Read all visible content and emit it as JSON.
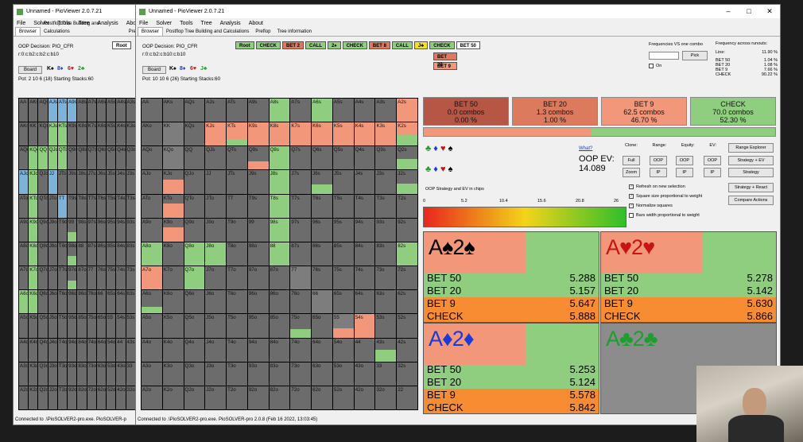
{
  "back_window": {
    "title": "Unnamed - PioViewer 2.0.7.21",
    "menu": [
      "File",
      "Solver",
      "Tools",
      "Tree",
      "Analysis",
      "Abo"
    ],
    "tabs": [
      "Browser",
      "Postflop Tree Building and Calculations",
      "Pre"
    ],
    "oop_decision": "OOP Decision:  PIO_CFR",
    "actions_line": "r:0:c:b2:c:b2:c:b10",
    "board_label": "Board",
    "board_cards": [
      "K♠",
      "8♦",
      "6♥",
      "2♣"
    ],
    "pot_line": "Pot: 2 10 6 (18) Starting Stacks:60",
    "root_label": "Root",
    "status": "Connected to .\\PioSOLVER2-pro.exe. PioSOLVER-p"
  },
  "window": {
    "title": "Unnamed - PioViewer 2.0.7.21",
    "controls": [
      "–",
      "□",
      "✕"
    ],
    "menu": [
      "File",
      "Solver",
      "Tools",
      "Tree",
      "Analysis",
      "About"
    ],
    "tabs": [
      "Browser",
      "Postflop Tree Building and Calculations",
      "Preflop",
      "Tree information"
    ],
    "oop_decision": "OOP Decision:  PIO_CFR",
    "actions_line": "r:0:c:b2:c:b10:c:b10",
    "board_label": "Board",
    "board_cards": [
      "K♠",
      "8♦",
      "6♥",
      "J♣"
    ],
    "pot_line": "Pot: 10 10 6 (26) Starting Stacks:60",
    "status": "Connected to .\\PioSOLVER2-pro.exe. PioSOLVER-pro 2.0.8 (Feb 16 2022, 13:03:45)"
  },
  "action_bar": [
    "Root",
    "CHECK",
    "BET 2",
    "CALL",
    "2♠",
    "CHECK",
    "BET 8",
    "CALL",
    "J♣",
    "CHECK",
    "BET 50"
  ],
  "dropdown": [
    "BET 20",
    "BET 9"
  ],
  "freq_panel": {
    "title": "Frequencies VS one combo",
    "pick_label": "Pick",
    "on_label": "On",
    "freq_title": "Frequency across runouts:",
    "line_label": "Line:",
    "line_value": "11.90 %",
    "rows": [
      {
        "name": "BET 50",
        "value": "1.04 %"
      },
      {
        "name": "BET 20",
        "value": "1.08 %"
      },
      {
        "name": "BET 9",
        "value": "7.66 %"
      },
      {
        "name": "CHECK",
        "value": "90.22 %"
      }
    ]
  },
  "strategy_boxes": [
    {
      "name": "BET 50",
      "combos": "0.0 combos",
      "pct": "0.00 %",
      "color": "#b65645"
    },
    {
      "name": "BET 20",
      "combos": "1.3 combos",
      "pct": "1.00 %",
      "color": "#dc7a5e"
    },
    {
      "name": "BET 9",
      "combos": "62.5 combos",
      "pct": "46.70 %",
      "color": "#f3977a"
    },
    {
      "name": "CHECK",
      "combos": "70.0 combos",
      "pct": "52.30 %",
      "color": "#8fce7f"
    }
  ],
  "freq_bar": {
    "check_fraction": 0.523
  },
  "ev": {
    "what_label": "What?",
    "label": "OOP EV:",
    "value": "14.089",
    "chart_label": "OOP Strategy and EV in chips",
    "ticks": [
      "0",
      "5.2",
      "10.4",
      "15.6",
      "20.8",
      "26"
    ]
  },
  "options": {
    "clone_label": "Clone:",
    "range_label": "Range:",
    "equity_label": "Equity:",
    "ev_label": "EV:",
    "full": "Full",
    "zoom": "Zoom",
    "oop": "OOP",
    "ip": "IP",
    "range_explorer": "Range Explorer",
    "strategy_ev": "Strategy + EV",
    "strategy": "Strategy",
    "strategy_react": "Strategy + React",
    "compare_actions": "Compare Actions",
    "checks": [
      {
        "label": "Refresh on new selection",
        "checked": true
      },
      {
        "label": "Square size proportional to weight",
        "checked": true
      },
      {
        "label": "Normalize squares",
        "checked": true
      },
      {
        "label": "Bars width proportional to weight",
        "checked": false
      }
    ]
  },
  "combos": [
    {
      "rank": "A",
      "suit": "♠",
      "rank2": "2",
      "color": "#000",
      "rows": [
        {
          "name": "BET 50",
          "value": "5.288"
        },
        {
          "name": "BET 20",
          "value": "5.157"
        },
        {
          "name": "BET 9",
          "value": "5.647"
        },
        {
          "name": "CHECK",
          "value": "5.888"
        }
      ]
    },
    {
      "rank": "A",
      "suit": "♥",
      "rank2": "2",
      "color": "#c81414",
      "rows": [
        {
          "name": "BET 50",
          "value": "5.278"
        },
        {
          "name": "BET 20",
          "value": "5.142"
        },
        {
          "name": "BET 9",
          "value": "5.630"
        },
        {
          "name": "CHECK",
          "value": "5.866"
        }
      ]
    },
    {
      "rank": "A",
      "suit": "♦",
      "rank2": "2",
      "color": "#1d39d6",
      "rows": [
        {
          "name": "BET 50",
          "value": "5.253"
        },
        {
          "name": "BET 20",
          "value": "5.124"
        },
        {
          "name": "BET 9",
          "value": "5.578"
        },
        {
          "name": "CHECK",
          "value": "5.842"
        }
      ]
    },
    {
      "rank": "A",
      "suit": "♣",
      "rank2": "2",
      "color": "#1e9e2e",
      "rows": []
    }
  ],
  "grid_labels": [
    [
      "AA",
      "AKs",
      "AQs",
      "AJs",
      "ATs",
      "A9s",
      "A8s",
      "A7s",
      "A6s",
      "A5s",
      "A4s",
      "A3s",
      "A2s"
    ],
    [
      "AKo",
      "KK",
      "KQs",
      "KJs",
      "KTs",
      "K9s",
      "K8s",
      "K7s",
      "K6s",
      "K5s",
      "K4s",
      "K3s",
      "K2s"
    ],
    [
      "AQo",
      "KQo",
      "QQ",
      "QJs",
      "QTs",
      "Q9s",
      "Q8s",
      "Q7s",
      "Q6s",
      "Q5s",
      "Q4s",
      "Q3s",
      "Q2s"
    ],
    [
      "AJo",
      "KJo",
      "QJo",
      "JJ",
      "JTs",
      "J9s",
      "J8s",
      "J7s",
      "J6s",
      "J5s",
      "J4s",
      "J3s",
      "J2s"
    ],
    [
      "ATo",
      "KTo",
      "QTo",
      "JTo",
      "TT",
      "T9s",
      "T8s",
      "T7s",
      "T6s",
      "T5s",
      "T4s",
      "T3s",
      "T2s"
    ],
    [
      "A9o",
      "K9o",
      "Q9o",
      "J9o",
      "T9o",
      "99",
      "98s",
      "97s",
      "96s",
      "95s",
      "94s",
      "93s",
      "92s"
    ],
    [
      "A8o",
      "K8o",
      "Q8o",
      "J8o",
      "T8o",
      "98o",
      "88",
      "87s",
      "86s",
      "85s",
      "84s",
      "83s",
      "82s"
    ],
    [
      "A7o",
      "K7o",
      "Q7o",
      "J7o",
      "T7o",
      "97o",
      "87o",
      "77",
      "76s",
      "75s",
      "74s",
      "73s",
      "72s"
    ],
    [
      "A6o",
      "K6o",
      "Q6o",
      "J6o",
      "T6o",
      "96o",
      "86o",
      "76o",
      "66",
      "65s",
      "64s",
      "63s",
      "62s"
    ],
    [
      "A5o",
      "K5o",
      "Q5o",
      "J5o",
      "T5o",
      "95o",
      "85o",
      "75o",
      "65o",
      "55",
      "54s",
      "53s",
      "52s"
    ],
    [
      "A4o",
      "K4o",
      "Q4o",
      "J4o",
      "T4o",
      "94o",
      "84o",
      "74o",
      "64o",
      "54o",
      "44",
      "43s",
      "42s"
    ],
    [
      "A3o",
      "K3o",
      "Q3o",
      "J3o",
      "T3o",
      "93o",
      "83o",
      "73o",
      "63o",
      "53o",
      "43o",
      "33",
      "32s"
    ],
    [
      "A2o",
      "K2o",
      "Q2o",
      "J2o",
      "T2o",
      "92o",
      "82o",
      "72o",
      "62o",
      "52o",
      "42o",
      "32o",
      "22"
    ]
  ]
}
